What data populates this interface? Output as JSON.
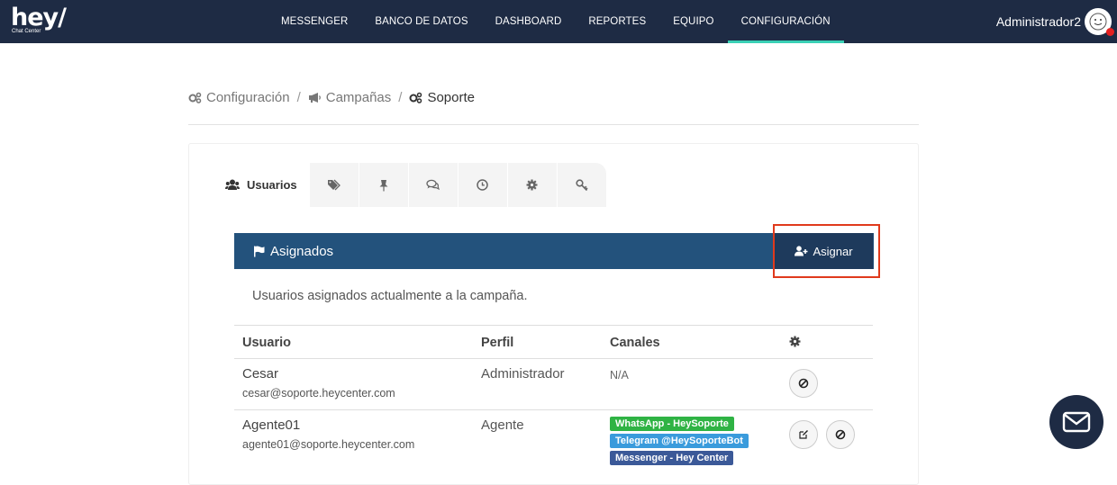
{
  "brand": {
    "logo": "hey/",
    "tagline": "Chat Center"
  },
  "nav": [
    {
      "label": "MESSENGER"
    },
    {
      "label": "BANCO DE DATOS"
    },
    {
      "label": "DASHBOARD"
    },
    {
      "label": "REPORTES"
    },
    {
      "label": "EQUIPO"
    },
    {
      "label": "CONFIGURACIÓN",
      "active": true
    }
  ],
  "user": {
    "name": "Administrador2",
    "avatar_icon": "smiley-avatar-icon",
    "status_color": "#e52020"
  },
  "breadcrumb": [
    {
      "label": "Configuración",
      "icon": "cogs-icon"
    },
    {
      "label": "Campañas",
      "icon": "megaphone-icon"
    },
    {
      "label": "Soporte",
      "icon": "cogs-icon"
    }
  ],
  "tabs": {
    "active_label": "Usuarios",
    "active_icon": "users-icon",
    "icons": [
      "tags-icon",
      "pin-icon",
      "chat-icon",
      "clock-icon",
      "gear-icon",
      "key-icon"
    ]
  },
  "panel": {
    "title": "Asignados",
    "title_icon": "flag-icon",
    "assign_label": "Asignar",
    "assign_icon": "user-plus-icon",
    "description": "Usuarios asignados actualmente a la campaña."
  },
  "table": {
    "columns": [
      "Usuario",
      "Perfil",
      "Canales"
    ],
    "settings_icon": "gear-icon",
    "rows": [
      {
        "name": "Cesar",
        "email": "cesar@soporte.heycenter.com",
        "profile": "Administrador",
        "channels_text": "N/A",
        "channels": [],
        "actions": [
          "block-icon"
        ]
      },
      {
        "name": "Agente01",
        "email": "agente01@soporte.heycenter.com",
        "profile": "Agente",
        "channels_text": "",
        "channels": [
          {
            "label": "WhatsApp - HeySoporte",
            "color": "#2fb344"
          },
          {
            "label": "Telegram @HeySoporteBot",
            "color": "#3a9bdc"
          },
          {
            "label": "Messenger - Hey Center",
            "color": "#3b5998"
          }
        ],
        "actions": [
          "edit-icon",
          "block-icon"
        ]
      }
    ]
  },
  "chat_button_icon": "envelope-icon",
  "colors": {
    "navbar": "#1e2b44",
    "active_underline": "#3ad0b5",
    "panel_header": "#23527c",
    "highlight": "#e03a1c"
  }
}
